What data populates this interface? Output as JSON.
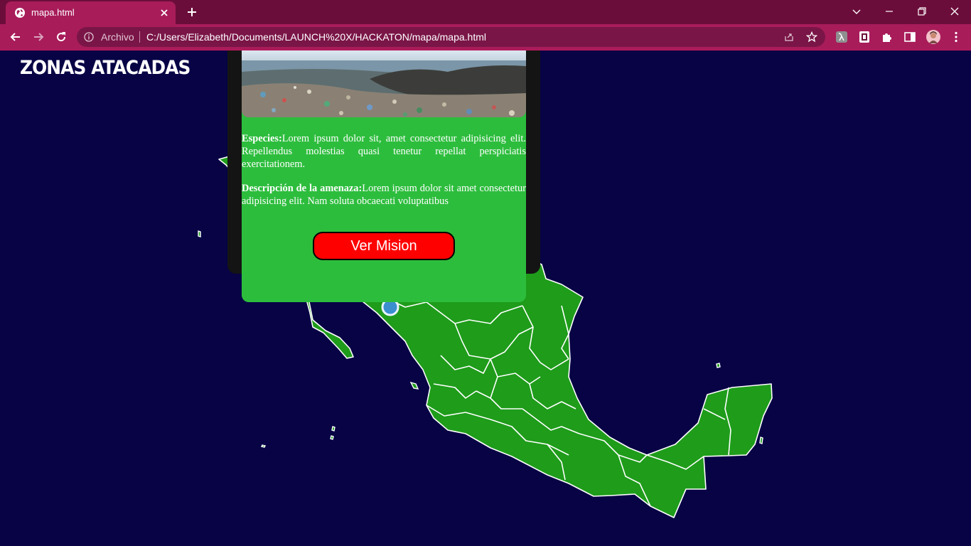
{
  "browser": {
    "tab_title": "mapa.html",
    "address_scheme": "Archivo",
    "address_url": "C:/Users/Elizabeth/Documents/LAUNCH%20X/HACKATON/mapa/mapa.html"
  },
  "page": {
    "title": "ZONAS ATACADAS",
    "colors": {
      "background": "#070345",
      "land": "#1e9c1a",
      "card": "#2dbd3d",
      "button": "#ff0000",
      "marker": "#3b8fcf"
    }
  },
  "popup": {
    "species_label": "Especies:",
    "species_text": "Lorem ipsum dolor sit, amet consectetur adipisicing elit. Repellendus molestias quasi tenetur repellat perspiciatis exercitationem.",
    "threat_label": "Descripción de la amenaza:",
    "threat_text": "Lorem ipsum dolor sit amet consectetur adipisicing elit. Nam soluta obcaecati voluptatibus",
    "button_label": "Ver Mision"
  }
}
